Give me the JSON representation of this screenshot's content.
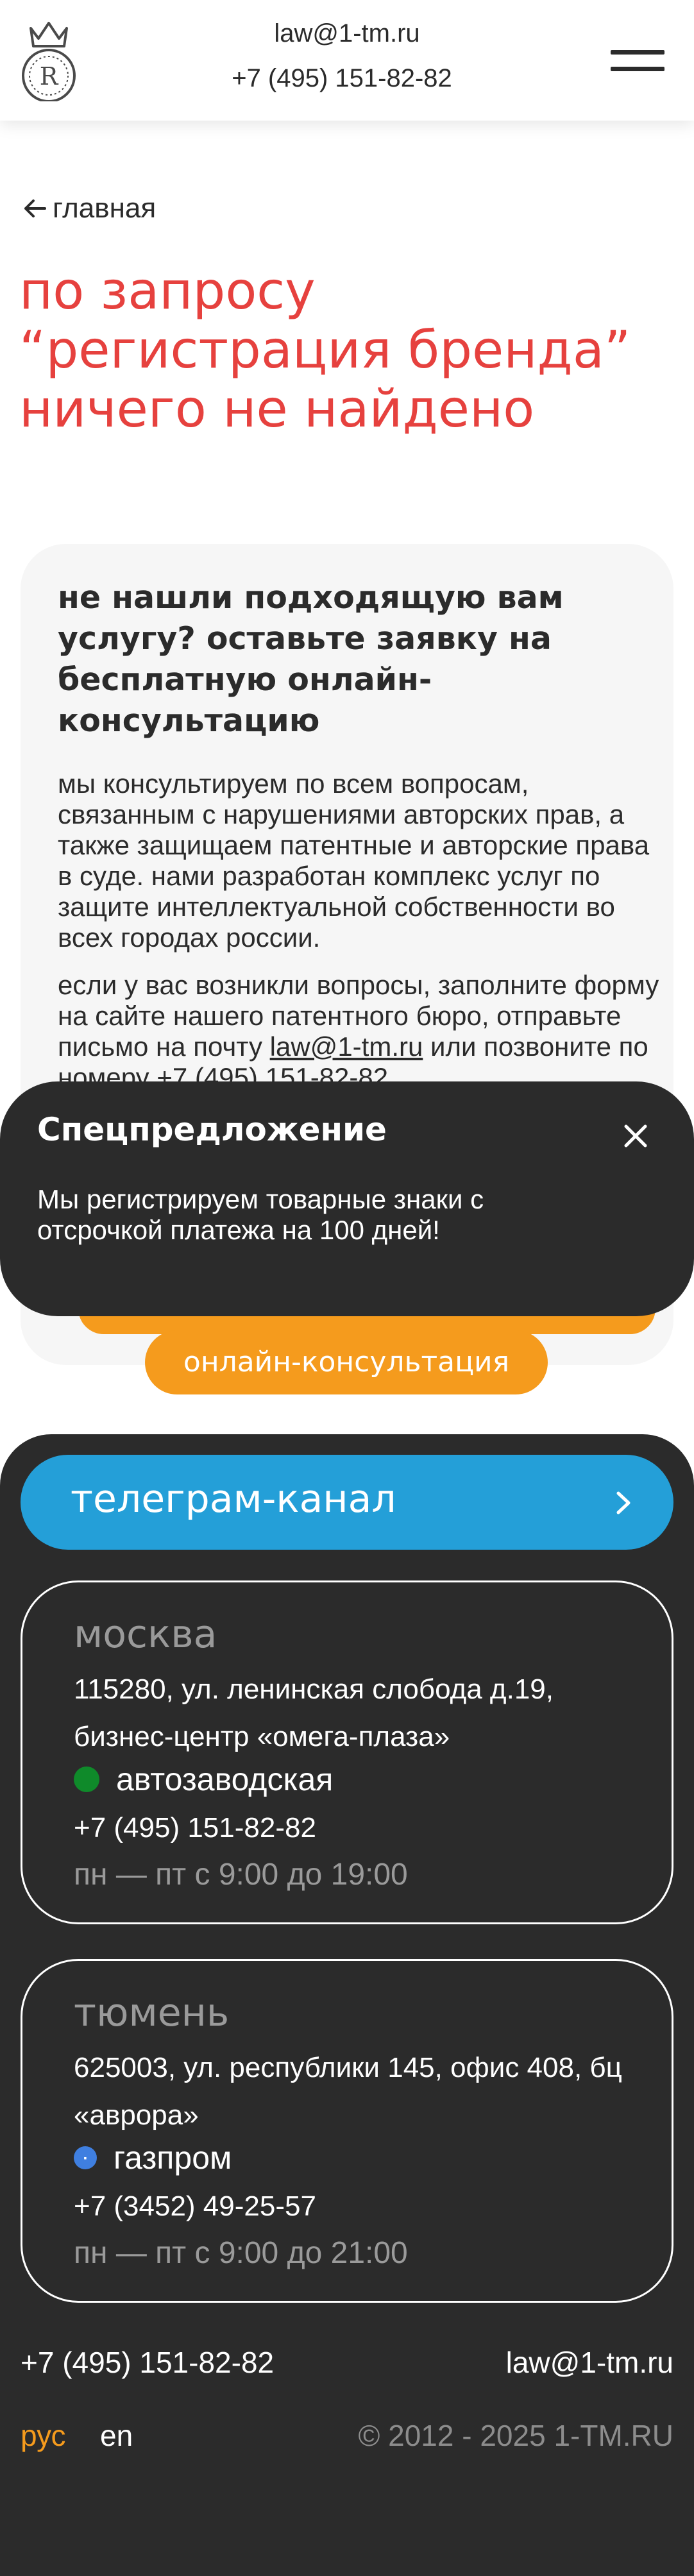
{
  "header": {
    "email": "law@1-tm.ru",
    "phone": "+7 (495) 151-82-82"
  },
  "nav": {
    "back_label": "главная"
  },
  "search": {
    "result_title": "по запросу “регистрация бренда” ничего не найдено"
  },
  "consultation": {
    "heading": "не нашли подходящую вам услугу? оставьте заявку на бесплатную онлайн-консультацию",
    "paragraph1": "мы консультируем по всем вопросам, связанным с нарушениями авторских прав, а также защищаем патентные и авторские права в суде. нами разработан комплекс услуг по защите интеллектуальной собственности во всех городах россии.",
    "paragraph2_before": "если у вас возникли вопросы, заполните форму на сайте нашего патентного бюро, отправьте письмо на почту ",
    "paragraph2_email": "law@1-tm.ru",
    "paragraph2_middle": " или позвоните по номеру ",
    "paragraph2_phone": "+7 (495) 151-82-82",
    "button_label": "онлайн-консультация"
  },
  "popup": {
    "title": "Спецпредложение",
    "text": "Мы регистрируем товарные знаки с отсрочкой платежа на 100 дней!"
  },
  "telegram": {
    "label": "телеграм-канал"
  },
  "offices": [
    {
      "city": "москва",
      "address": "115280, ул. ленинская слобода д.19, бизнес-центр «омега-плаза»",
      "metro": "автозаводская",
      "phone": "+7 (495) 151-82-82",
      "hours": "пн — пт с 9:00 до 19:00"
    },
    {
      "city": "тюмень",
      "address": "625003, ул. республики 145, офис 408, бц «аврора»",
      "metro": "газпром",
      "phone": "+7 (3452) 49-25-57",
      "hours": "пн — пт с 9:00 до 21:00"
    }
  ],
  "footer": {
    "phone": "+7 (495) 151-82-82",
    "email": "law@1-tm.ru",
    "lang_ru": "рус",
    "lang_en": "en",
    "copyright": "© 2012 - 2025 1-TM.RU"
  },
  "colors": {
    "accent_red": "#e6413e",
    "accent_orange": "#f59b1d",
    "telegram_blue": "#249fd8",
    "dark_bg": "#2b2b2b"
  }
}
